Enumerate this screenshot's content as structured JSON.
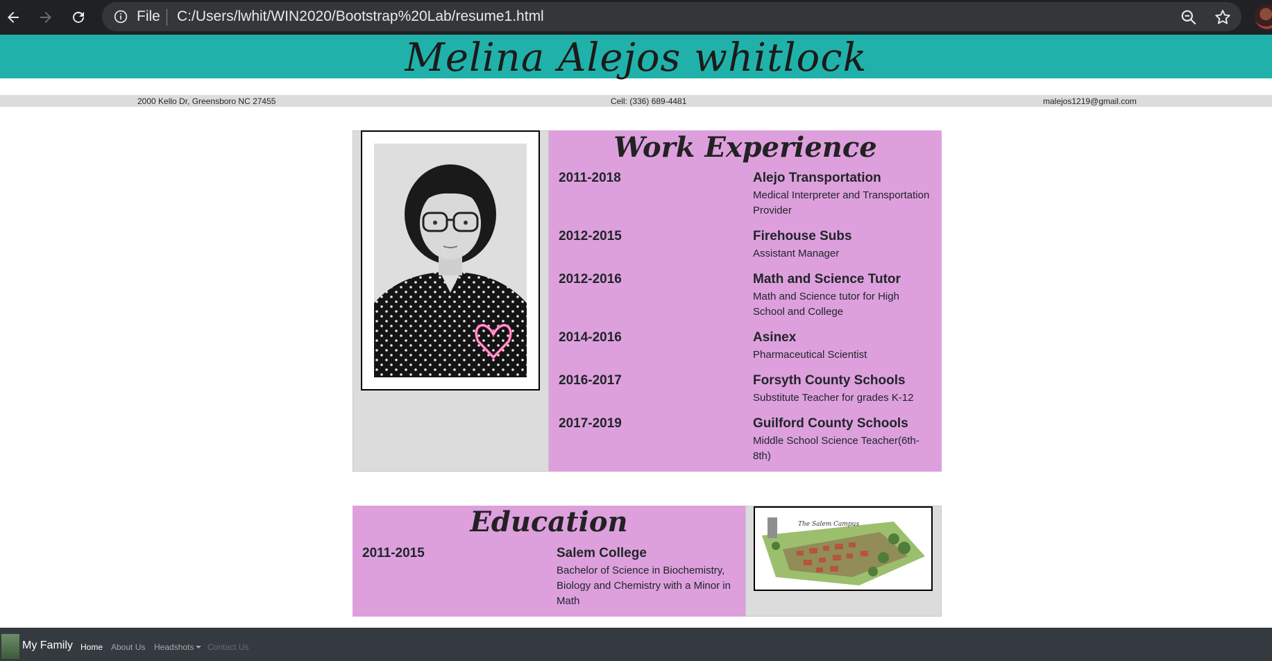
{
  "browser": {
    "scheme": "File",
    "url": "C:/Users/lwhit/WIN2020/Bootstrap%20Lab/resume1.html"
  },
  "header": {
    "name": "Melina Alejos whitlock",
    "address": "2000 Kello Dr, Greensboro NC 27455",
    "cell": "Cell: (336) 689-4481",
    "email": "malejos1219@gmail.com"
  },
  "work": {
    "title": "Work Experience",
    "items": [
      {
        "years": "2011-2018",
        "place": "Alejo Transportation",
        "desc": "Medical Interpreter and Transportation Provider"
      },
      {
        "years": "2012-2015",
        "place": "Firehouse Subs",
        "desc": "Assistant Manager"
      },
      {
        "years": "2012-2016",
        "place": "Math and Science Tutor",
        "desc": "Math and Science tutor for High School and College"
      },
      {
        "years": "2014-2016",
        "place": "Asinex",
        "desc": "Pharmaceutical Scientist"
      },
      {
        "years": "2016-2017",
        "place": "Forsyth County Schools",
        "desc": "Substitute Teacher for grades K-12"
      },
      {
        "years": "2017-2019",
        "place": "Guilford County Schools",
        "desc": "Middle School Science Teacher(6th-8th)"
      }
    ]
  },
  "education": {
    "title": "Education",
    "items": [
      {
        "years": "2011-2015",
        "place": "Salem College",
        "desc": "Bachelor of Science in Biochemistry, Biology and Chemistry with a Minor in Math"
      }
    ],
    "campus_caption": "The Salem Campus"
  },
  "footer": {
    "brand": "My Family",
    "links": [
      "Home",
      "About Us",
      "Headshots",
      "Contact Us"
    ]
  },
  "colors": {
    "banner": "#20b2aa",
    "card_pink": "#dda0dd",
    "card_grey": "#dcdcdc",
    "navbar": "#343a40"
  }
}
